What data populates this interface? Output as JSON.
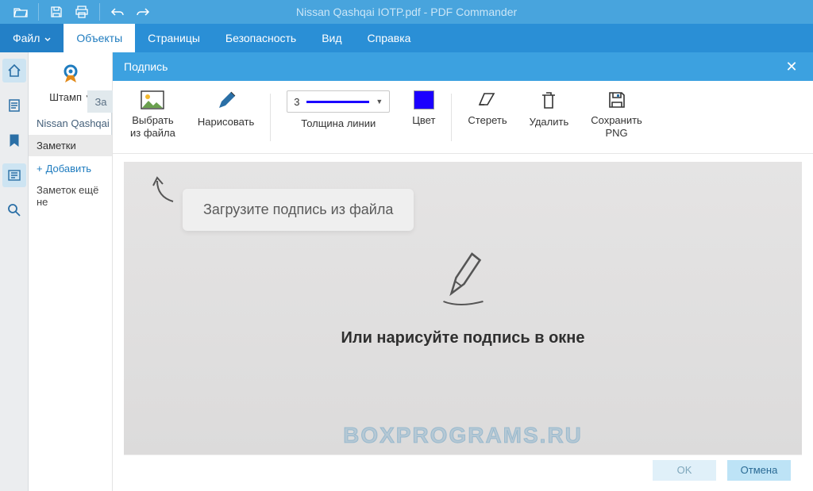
{
  "titlebar": {
    "title": "Nissan Qashqai IOTP.pdf - PDF Commander"
  },
  "menu": {
    "file": "Файл",
    "objects": "Объекты",
    "pages": "Страницы",
    "security": "Безопасность",
    "view": "Вид",
    "help": "Справка"
  },
  "objectsbar": {
    "stamp": "Штамп"
  },
  "leftpanel": {
    "fragment": "За",
    "tab0": "Nissan Qashqai I",
    "notes_header": "Заметки",
    "add": "Добавить",
    "empty": "Заметок ещё не"
  },
  "modal": {
    "title": "Подпись",
    "tools": {
      "fromfile": "Выбрать\nиз файла",
      "draw": "Нарисовать",
      "thickness": "Толщина линии",
      "thickness_val": "3",
      "color": "Цвет",
      "erase": "Стереть",
      "delete": "Удалить",
      "savepng": "Сохранить\nPNG",
      "color_hex": "#1b00ff"
    },
    "hint": "Загрузите подпись из файла",
    "center": "Или нарисуйте подпись в окне",
    "watermark": "BOXPROGRAMS.RU",
    "ok": "OK",
    "cancel": "Отмена"
  }
}
